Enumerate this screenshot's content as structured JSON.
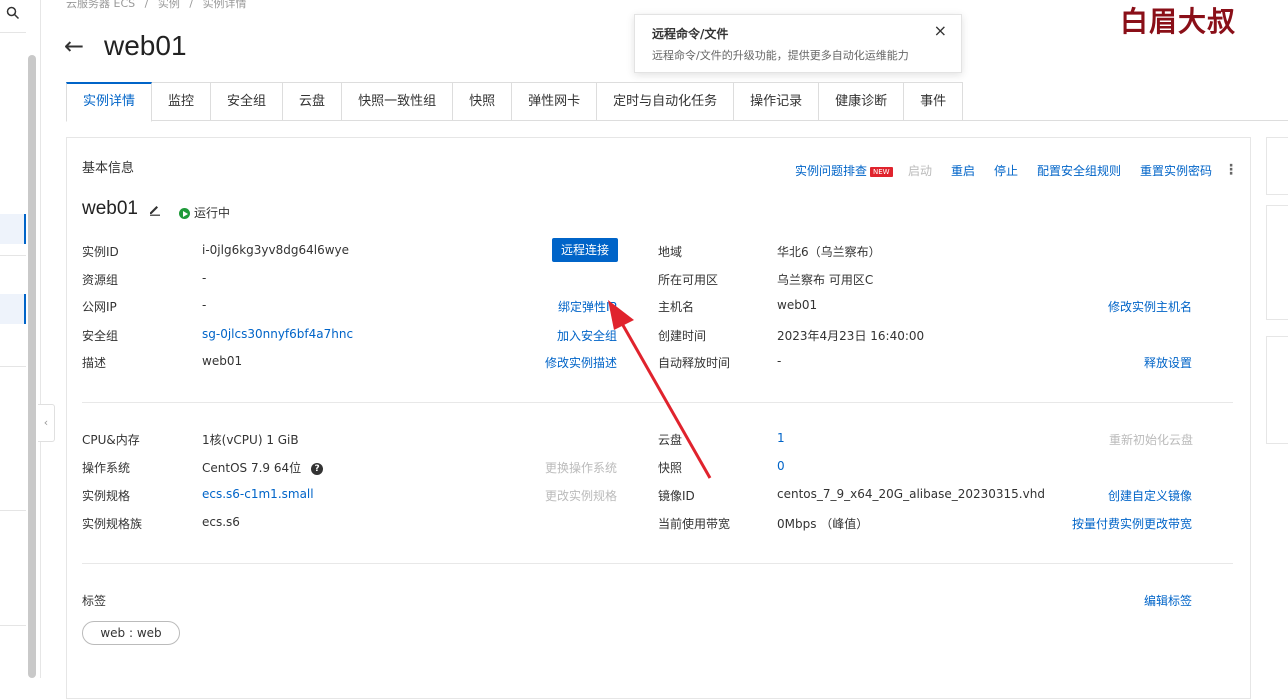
{
  "breadcrumb": [
    "云服务器 ECS",
    "/",
    "实例",
    "/",
    "实例详情"
  ],
  "header": {
    "back_icon": "←",
    "title": "web01"
  },
  "popover": {
    "title": "远程命令/文件",
    "desc": "远程命令/文件的升级功能，提供更多自动化运维能力",
    "close": "×"
  },
  "watermark": "白眉大叔",
  "tabs": [
    "实例详情",
    "监控",
    "安全组",
    "云盘",
    "快照一致性组",
    "快照",
    "弹性网卡",
    "定时与自动化任务",
    "操作记录",
    "健康诊断",
    "事件"
  ],
  "basic": {
    "section_title": "基本信息",
    "actions": {
      "troubleshoot": "实例问题排查",
      "new_badge": "NEW",
      "start": "启动",
      "restart": "重启",
      "stop": "停止",
      "sg_rules": "配置安全组规则",
      "reset_pwd": "重置实例密码",
      "more": "⋮"
    },
    "instance_name": "web01",
    "status": "运行中",
    "remote_connect": "远程连接",
    "left": [
      {
        "label": "实例ID",
        "value": "i-0jlg6kg3yv8dg64l6wye"
      },
      {
        "label": "资源组",
        "value": "-"
      },
      {
        "label": "公网IP",
        "value": "-",
        "action": "绑定弹性IP"
      },
      {
        "label": "安全组",
        "value": "sg-0jlcs30nnyf6bf4a7hnc",
        "action": "加入安全组"
      },
      {
        "label": "描述",
        "value": "web01",
        "action": "修改实例描述"
      }
    ],
    "right": [
      {
        "label": "地域",
        "value": "华北6（乌兰察布）"
      },
      {
        "label": "所在可用区",
        "value": "乌兰察布 可用区C"
      },
      {
        "label": "主机名",
        "value": "web01",
        "action": "修改实例主机名"
      },
      {
        "label": "创建时间",
        "value": "2023年4月23日 16:40:00"
      },
      {
        "label": "自动释放时间",
        "value": "-",
        "action": "释放设置"
      }
    ]
  },
  "config": {
    "left": [
      {
        "label": "CPU&内存",
        "value": "1核(vCPU) 1 GiB"
      },
      {
        "label": "操作系统",
        "value": "CentOS 7.9 64位",
        "action": "更换操作系统"
      },
      {
        "label": "实例规格",
        "value": "ecs.s6-c1m1.small",
        "action": "更改实例规格"
      },
      {
        "label": "实例规格族",
        "value": "ecs.s6"
      }
    ],
    "right": [
      {
        "label": "云盘",
        "value": "1",
        "action": "重新初始化云盘"
      },
      {
        "label": "快照",
        "value": "0"
      },
      {
        "label": "镜像ID",
        "value": "centos_7_9_x64_20G_alibase_20230315.vhd",
        "action": "创建自定义镜像"
      },
      {
        "label": "当前使用带宽",
        "value": "0Mbps （峰值）",
        "action": "按量付费实例更改带宽"
      }
    ]
  },
  "tags": {
    "label": "标签",
    "edit": "编辑标签",
    "items": [
      "web : web"
    ]
  },
  "colors": {
    "primary": "#0064c8",
    "running": "#1f9a3a",
    "arrow": "#e0232d",
    "watermark": "#8a0f18"
  }
}
